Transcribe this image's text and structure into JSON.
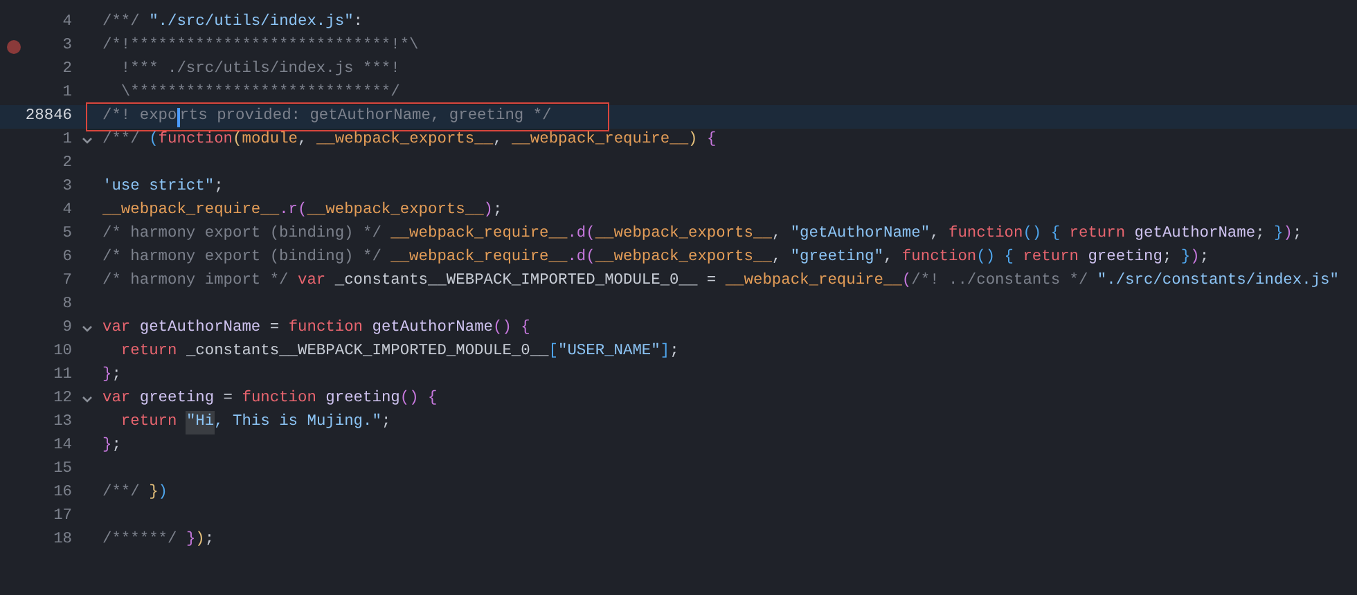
{
  "editor": {
    "lines": [
      {
        "number": "4",
        "breakpoint": false,
        "fold": false,
        "current": false,
        "tokens": [
          {
            "kind": "comment",
            "text": "/**/ "
          },
          {
            "kind": "string",
            "text": "\"./src/utils/index.js\""
          },
          {
            "kind": "plain",
            "text": ":"
          }
        ]
      },
      {
        "number": "3",
        "breakpoint": true,
        "fold": false,
        "current": false,
        "tokens": [
          {
            "kind": "comment",
            "text": "/*!****************************!*\\"
          }
        ]
      },
      {
        "number": "2",
        "breakpoint": false,
        "fold": false,
        "current": false,
        "tokens": [
          {
            "kind": "comment",
            "text": "  !*** ./src/utils/index.js ***!"
          }
        ]
      },
      {
        "number": "1",
        "breakpoint": false,
        "fold": false,
        "current": false,
        "tokens": [
          {
            "kind": "comment",
            "text": "  \\****************************/"
          }
        ]
      },
      {
        "number": "28846",
        "breakpoint": false,
        "fold": false,
        "current": true,
        "tokens": [
          {
            "kind": "comment",
            "text": "/*! expo"
          },
          {
            "kind": "cursor"
          },
          {
            "kind": "comment",
            "text": "rts provided: getAuthorName, greeting */"
          }
        ]
      },
      {
        "number": "1",
        "breakpoint": false,
        "fold": true,
        "current": false,
        "tokens": [
          {
            "kind": "comment",
            "text": "/**/ "
          },
          {
            "kind": "bracket3",
            "text": "("
          },
          {
            "kind": "keyword",
            "text": "function"
          },
          {
            "kind": "bracket1",
            "text": "("
          },
          {
            "kind": "orange",
            "text": "module"
          },
          {
            "kind": "plain",
            "text": ", "
          },
          {
            "kind": "orange",
            "text": "__webpack_exports__"
          },
          {
            "kind": "plain",
            "text": ", "
          },
          {
            "kind": "orange",
            "text": "__webpack_require__"
          },
          {
            "kind": "bracket1",
            "text": ")"
          },
          {
            "kind": "bracket2",
            "text": " {"
          }
        ]
      },
      {
        "number": "2",
        "breakpoint": false,
        "fold": false,
        "current": false
      },
      {
        "number": "3",
        "breakpoint": false,
        "fold": false,
        "current": false,
        "tokens": [
          {
            "kind": "string",
            "text": "'use strict\""
          },
          {
            "kind": "plain",
            "text": ";"
          }
        ]
      },
      {
        "number": "4",
        "breakpoint": false,
        "fold": false,
        "current": false,
        "tokens": [
          {
            "kind": "orange",
            "text": "__webpack_require__"
          },
          {
            "kind": "method",
            "text": ".r"
          },
          {
            "kind": "bracket2",
            "text": "("
          },
          {
            "kind": "orange",
            "text": "__webpack_exports__"
          },
          {
            "kind": "bracket2",
            "text": ")"
          },
          {
            "kind": "plain",
            "text": ";"
          }
        ]
      },
      {
        "number": "5",
        "breakpoint": false,
        "fold": false,
        "current": false,
        "tokens": [
          {
            "kind": "comment",
            "text": "/* harmony export (binding) */ "
          },
          {
            "kind": "orange",
            "text": "__webpack_require__"
          },
          {
            "kind": "method",
            "text": ".d"
          },
          {
            "kind": "bracket2",
            "text": "("
          },
          {
            "kind": "orange",
            "text": "__webpack_exports__"
          },
          {
            "kind": "plain",
            "text": ", "
          },
          {
            "kind": "string",
            "text": "\"getAuthorName\""
          },
          {
            "kind": "plain",
            "text": ", "
          },
          {
            "kind": "keyword",
            "text": "function"
          },
          {
            "kind": "bracket3",
            "text": "() {"
          },
          {
            "kind": "keyword",
            "text": " return "
          },
          {
            "kind": "ident",
            "text": "getAuthorName"
          },
          {
            "kind": "plain",
            "text": "; "
          },
          {
            "kind": "bracket3",
            "text": "}"
          },
          {
            "kind": "bracket2",
            "text": ")"
          },
          {
            "kind": "plain",
            "text": ";"
          }
        ]
      },
      {
        "number": "6",
        "breakpoint": false,
        "fold": false,
        "current": false,
        "tokens": [
          {
            "kind": "comment",
            "text": "/* harmony export (binding) */ "
          },
          {
            "kind": "orange",
            "text": "__webpack_require__"
          },
          {
            "kind": "method",
            "text": ".d"
          },
          {
            "kind": "bracket2",
            "text": "("
          },
          {
            "kind": "orange",
            "text": "__webpack_exports__"
          },
          {
            "kind": "plain",
            "text": ", "
          },
          {
            "kind": "string",
            "text": "\"greeting\""
          },
          {
            "kind": "plain",
            "text": ", "
          },
          {
            "kind": "keyword",
            "text": "function"
          },
          {
            "kind": "bracket3",
            "text": "() {"
          },
          {
            "kind": "keyword",
            "text": " return "
          },
          {
            "kind": "ident",
            "text": "greeting"
          },
          {
            "kind": "plain",
            "text": "; "
          },
          {
            "kind": "bracket3",
            "text": "}"
          },
          {
            "kind": "bracket2",
            "text": ")"
          },
          {
            "kind": "plain",
            "text": ";"
          }
        ]
      },
      {
        "number": "7",
        "breakpoint": false,
        "fold": false,
        "current": false,
        "tokens": [
          {
            "kind": "comment",
            "text": "/* harmony import */ "
          },
          {
            "kind": "keyword",
            "text": "var"
          },
          {
            "kind": "plain",
            "text": " _constants__WEBPACK_IMPORTED_MODULE_0__ = "
          },
          {
            "kind": "orange",
            "text": "__webpack_require__"
          },
          {
            "kind": "bracket2",
            "text": "("
          },
          {
            "kind": "comment",
            "text": "/*! ../constants */ "
          },
          {
            "kind": "string",
            "text": "\"./src/constants/index.js\""
          }
        ]
      },
      {
        "number": "8",
        "breakpoint": false,
        "fold": false,
        "current": false
      },
      {
        "number": "9",
        "breakpoint": false,
        "fold": true,
        "current": false,
        "tokens": [
          {
            "kind": "keyword",
            "text": "var"
          },
          {
            "kind": "ident",
            "text": " getAuthorName "
          },
          {
            "kind": "plain",
            "text": "= "
          },
          {
            "kind": "keyword",
            "text": "function"
          },
          {
            "kind": "ident",
            "text": " getAuthorName"
          },
          {
            "kind": "bracket2",
            "text": "() {"
          }
        ]
      },
      {
        "number": "10",
        "breakpoint": false,
        "fold": false,
        "current": false,
        "tokens": [
          {
            "kind": "keyword",
            "text": "  return "
          },
          {
            "kind": "plain",
            "text": "_constants__WEBPACK_IMPORTED_MODULE_0__"
          },
          {
            "kind": "bracket3",
            "text": "["
          },
          {
            "kind": "string",
            "text": "\"USER_NAME\""
          },
          {
            "kind": "bracket3",
            "text": "]"
          },
          {
            "kind": "plain",
            "text": ";"
          }
        ]
      },
      {
        "number": "11",
        "breakpoint": false,
        "fold": false,
        "current": false,
        "tokens": [
          {
            "kind": "bracket2",
            "text": "}"
          },
          {
            "kind": "plain",
            "text": ";"
          }
        ]
      },
      {
        "number": "12",
        "breakpoint": false,
        "fold": true,
        "current": false,
        "tokens": [
          {
            "kind": "keyword",
            "text": "var"
          },
          {
            "kind": "ident",
            "text": " greeting "
          },
          {
            "kind": "plain",
            "text": "= "
          },
          {
            "kind": "keyword",
            "text": "function"
          },
          {
            "kind": "ident",
            "text": " greeting"
          },
          {
            "kind": "bracket2",
            "text": "() {"
          }
        ]
      },
      {
        "number": "13",
        "breakpoint": false,
        "fold": false,
        "current": false,
        "tokens": [
          {
            "kind": "keyword",
            "text": "  return "
          },
          {
            "kind": "marked",
            "text": "\"Hi"
          },
          {
            "kind": "string",
            "text": ", This is Mujing.\""
          },
          {
            "kind": "plain",
            "text": ";"
          }
        ]
      },
      {
        "number": "14",
        "breakpoint": false,
        "fold": false,
        "current": false,
        "tokens": [
          {
            "kind": "bracket2",
            "text": "}"
          },
          {
            "kind": "plain",
            "text": ";"
          }
        ]
      },
      {
        "number": "15",
        "breakpoint": false,
        "fold": false,
        "current": false
      },
      {
        "number": "16",
        "breakpoint": false,
        "fold": false,
        "current": false,
        "tokens": [
          {
            "kind": "comment",
            "text": "/**/ "
          },
          {
            "kind": "bracket1",
            "text": "}"
          },
          {
            "kind": "bracket3",
            "text": ")"
          }
        ]
      },
      {
        "number": "17",
        "breakpoint": false,
        "fold": false,
        "current": false
      },
      {
        "number": "18",
        "breakpoint": false,
        "fold": false,
        "current": false,
        "tokens": [
          {
            "kind": "comment",
            "text": "/******/ "
          },
          {
            "kind": "bracket2",
            "text": "}"
          },
          {
            "kind": "bracket1",
            "text": ")"
          },
          {
            "kind": "plain",
            "text": ";"
          }
        ]
      }
    ]
  }
}
